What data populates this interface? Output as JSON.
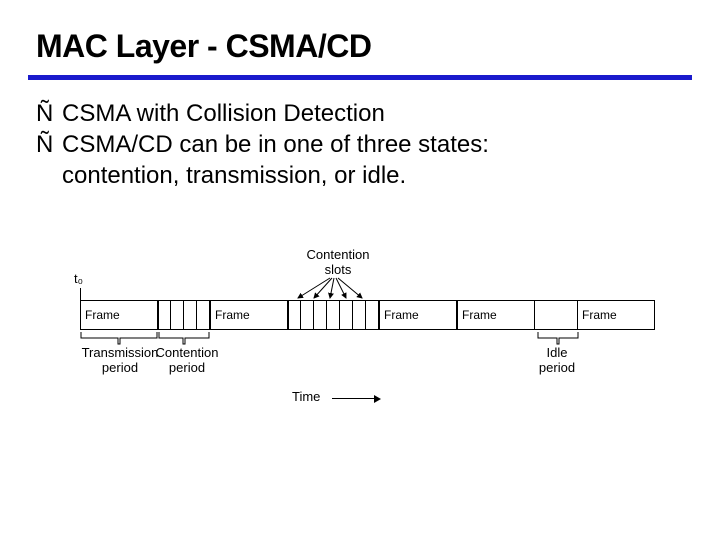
{
  "title": "MAC Layer - CSMA/CD",
  "bullets": {
    "mark": "Ñ",
    "items": [
      "CSMA with Collision Detection",
      "CSMA/CD can be in one of three states:"
    ],
    "continuation": "contention, transmission, or idle."
  },
  "diagram": {
    "t0_label": "t₀",
    "contention_label": "Contention\nslots",
    "frame_label": "Frame",
    "transmission_period_label": "Transmission\nperiod",
    "contention_period_label": "Contention\nperiod",
    "idle_period_label": "Idle\nperiod",
    "time_label": "Time"
  }
}
